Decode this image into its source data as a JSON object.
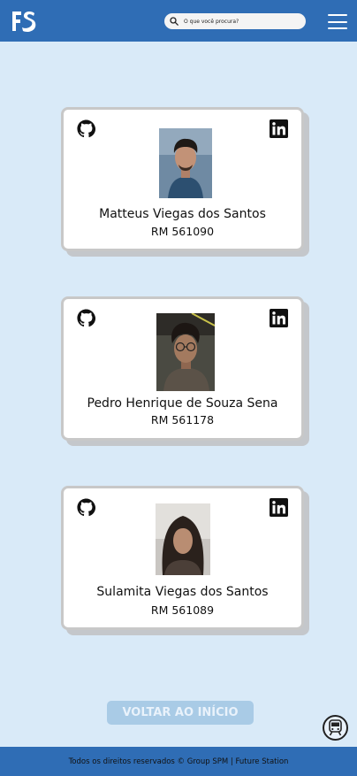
{
  "header": {
    "logo_text": "FS",
    "search_placeholder": "O que você procura?"
  },
  "members": [
    {
      "name": "Matteus Viegas dos Santos",
      "rm": "RM 561090"
    },
    {
      "name": "Pedro Henrique de Souza Sena",
      "rm": "RM 561178"
    },
    {
      "name": "Sulamita Viegas dos Santos",
      "rm": "RM 561089"
    }
  ],
  "actions": {
    "back_label": "VOLTAR AO INÍCIO"
  },
  "footer": {
    "text": "Todos os direitos reservados © Group SPM | Future Station"
  },
  "icons": {
    "logo": "fs-logo",
    "search": "search-icon",
    "menu": "hamburger-menu-icon",
    "github": "github-icon",
    "linkedin": "linkedin-icon",
    "train": "train-icon"
  },
  "colors": {
    "header_bg": "#2f6db5",
    "page_bg": "#d9eaf8",
    "button_bg": "#a9cbe6",
    "card_border": "#c8c8c8"
  }
}
